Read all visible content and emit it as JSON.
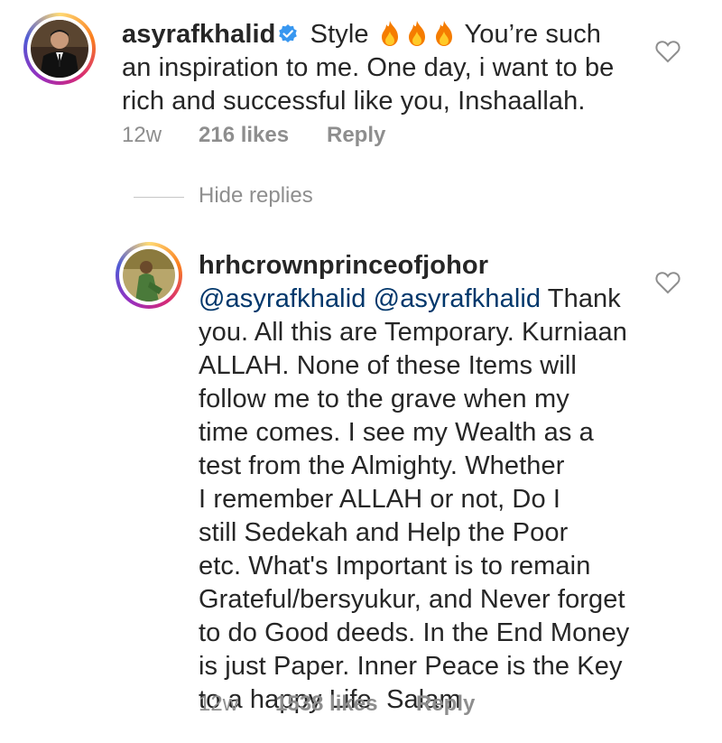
{
  "comment1": {
    "username": "asyrafkhalid",
    "text_start": "Style",
    "text_after_flames": "You’re such",
    "line2": "an inspiration to me. One day, i want to be",
    "line3": "rich and successful like you, Inshaallah.",
    "time": "12w",
    "likes": "216 likes",
    "reply": "Reply"
  },
  "replies_toggle": "Hide replies",
  "comment2": {
    "username": "hrhcrownprinceofjohor",
    "mention1": "@asyrafkhalid",
    "mention2": "@asyrafkhalid",
    "line1_end": "Thank",
    "lines": [
      "you. All this are Temporary. Kurniaan",
      "ALLAH. None of these Items will",
      "follow me to the grave when my",
      "time comes. I see my Wealth as a",
      "test from the Almighty. Whether",
      "I remember ALLAH or not, Do I",
      "still Sedekah and Help the Poor",
      "etc. What's Important is to remain",
      "Grateful/bersyukur, and Never forget",
      "to do Good deeds. In the End Money",
      "is just Paper. Inner Peace is the Key",
      "to a happy Life. Salam"
    ],
    "time": "12w",
    "likes": "1538 likes",
    "reply": "Reply"
  },
  "colors": {
    "text": "#262626",
    "meta": "#8e8e8e",
    "mention": "#00376b",
    "verified": "#3897f0"
  }
}
